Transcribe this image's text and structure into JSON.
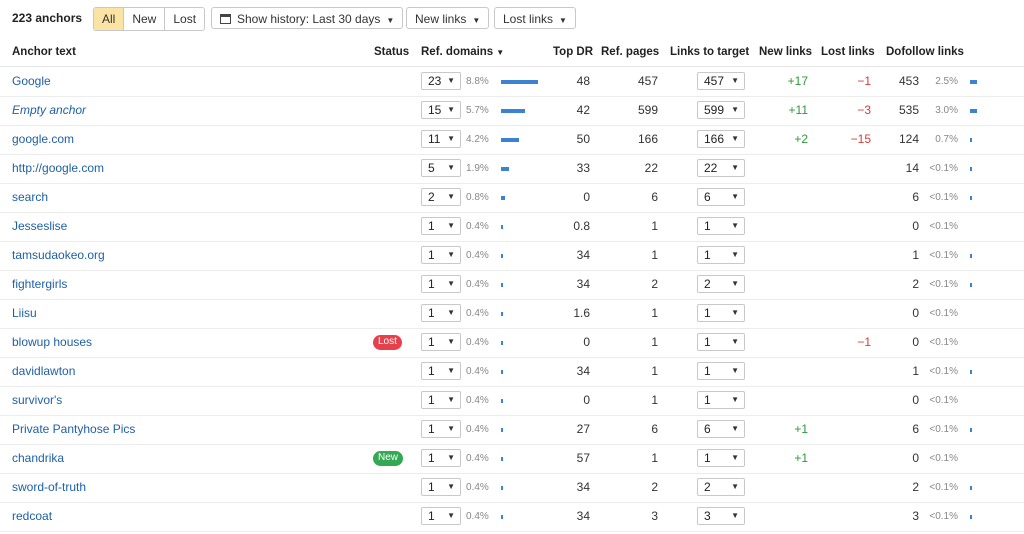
{
  "toolbar": {
    "count_label": "223 anchors",
    "filters": [
      "All",
      "New",
      "Lost"
    ],
    "history_label": "Show history: Last 30 days",
    "new_links_label": "New links",
    "lost_links_label": "Lost links"
  },
  "columns": {
    "anchor": "Anchor text",
    "status": "Status",
    "ref_domains": "Ref. domains",
    "top_dr": "Top DR",
    "ref_pages": "Ref. pages",
    "links_to_target": "Links to target",
    "new_links": "New links",
    "lost_links": "Lost links",
    "dofollow": "Dofollow links"
  },
  "colors": {
    "bar": "#3a83d3",
    "positive": "#2a9a3a",
    "negative": "#d93a3a",
    "lost_badge": "#e8404b",
    "new_badge": "#34a853",
    "active_filter": "#fbe3a4"
  },
  "rows": [
    {
      "anchor": "Google",
      "italic": false,
      "status": "",
      "ref_domains": "23",
      "rd_pct": "8.8%",
      "rd_bar": 1.0,
      "top_dr": "48",
      "ref_pages": "457",
      "links": "457",
      "new": "+17",
      "lost": "−1",
      "dofollow": "453",
      "df_pct": "2.5%",
      "df_bar": 1.0
    },
    {
      "anchor": "Empty anchor",
      "italic": true,
      "status": "",
      "ref_domains": "15",
      "rd_pct": "5.7%",
      "rd_bar": 0.65,
      "top_dr": "42",
      "ref_pages": "599",
      "links": "599",
      "new": "+11",
      "lost": "−3",
      "dofollow": "535",
      "df_pct": "3.0%",
      "df_bar": 1.0
    },
    {
      "anchor": "google.com",
      "italic": false,
      "status": "",
      "ref_domains": "11",
      "rd_pct": "4.2%",
      "rd_bar": 0.48,
      "top_dr": "50",
      "ref_pages": "166",
      "links": "166",
      "new": "+2",
      "lost": "−15",
      "dofollow": "124",
      "df_pct": "0.7%",
      "df_bar": 0.3
    },
    {
      "anchor": "http://google.com",
      "italic": false,
      "status": "",
      "ref_domains": "5",
      "rd_pct": "1.9%",
      "rd_bar": 0.22,
      "top_dr": "33",
      "ref_pages": "22",
      "links": "22",
      "new": "",
      "lost": "",
      "dofollow": "14",
      "df_pct": "<0.1%",
      "df_bar": 0.15
    },
    {
      "anchor": "search",
      "italic": false,
      "status": "",
      "ref_domains": "2",
      "rd_pct": "0.8%",
      "rd_bar": 0.1,
      "top_dr": "0",
      "ref_pages": "6",
      "links": "6",
      "new": "",
      "lost": "",
      "dofollow": "6",
      "df_pct": "<0.1%",
      "df_bar": 0.15
    },
    {
      "anchor": "Jesseslise",
      "italic": false,
      "status": "",
      "ref_domains": "1",
      "rd_pct": "0.4%",
      "rd_bar": 0.05,
      "top_dr": "0.8",
      "ref_pages": "1",
      "links": "1",
      "new": "",
      "lost": "",
      "dofollow": "0",
      "df_pct": "<0.1%",
      "df_bar": 0
    },
    {
      "anchor": "tamsudaokeo.org",
      "italic": false,
      "status": "",
      "ref_domains": "1",
      "rd_pct": "0.4%",
      "rd_bar": 0.05,
      "top_dr": "34",
      "ref_pages": "1",
      "links": "1",
      "new": "",
      "lost": "",
      "dofollow": "1",
      "df_pct": "<0.1%",
      "df_bar": 0.15
    },
    {
      "anchor": "fightergirls",
      "italic": false,
      "status": "",
      "ref_domains": "1",
      "rd_pct": "0.4%",
      "rd_bar": 0.05,
      "top_dr": "34",
      "ref_pages": "2",
      "links": "2",
      "new": "",
      "lost": "",
      "dofollow": "2",
      "df_pct": "<0.1%",
      "df_bar": 0.15
    },
    {
      "anchor": "Liisu",
      "italic": false,
      "status": "",
      "ref_domains": "1",
      "rd_pct": "0.4%",
      "rd_bar": 0.05,
      "top_dr": "1.6",
      "ref_pages": "1",
      "links": "1",
      "new": "",
      "lost": "",
      "dofollow": "0",
      "df_pct": "<0.1%",
      "df_bar": 0
    },
    {
      "anchor": "blowup houses",
      "italic": false,
      "status": "Lost",
      "ref_domains": "1",
      "rd_pct": "0.4%",
      "rd_bar": 0.05,
      "top_dr": "0",
      "ref_pages": "1",
      "links": "1",
      "new": "",
      "lost": "−1",
      "dofollow": "0",
      "df_pct": "<0.1%",
      "df_bar": 0
    },
    {
      "anchor": "davidlawton",
      "italic": false,
      "status": "",
      "ref_domains": "1",
      "rd_pct": "0.4%",
      "rd_bar": 0.05,
      "top_dr": "34",
      "ref_pages": "1",
      "links": "1",
      "new": "",
      "lost": "",
      "dofollow": "1",
      "df_pct": "<0.1%",
      "df_bar": 0.15
    },
    {
      "anchor": "survivor's",
      "italic": false,
      "status": "",
      "ref_domains": "1",
      "rd_pct": "0.4%",
      "rd_bar": 0.05,
      "top_dr": "0",
      "ref_pages": "1",
      "links": "1",
      "new": "",
      "lost": "",
      "dofollow": "0",
      "df_pct": "<0.1%",
      "df_bar": 0
    },
    {
      "anchor": "Private Pantyhose Pics",
      "italic": false,
      "status": "",
      "ref_domains": "1",
      "rd_pct": "0.4%",
      "rd_bar": 0.05,
      "top_dr": "27",
      "ref_pages": "6",
      "links": "6",
      "new": "+1",
      "lost": "",
      "dofollow": "6",
      "df_pct": "<0.1%",
      "df_bar": 0.15
    },
    {
      "anchor": "chandrika",
      "italic": false,
      "status": "New",
      "ref_domains": "1",
      "rd_pct": "0.4%",
      "rd_bar": 0.05,
      "top_dr": "57",
      "ref_pages": "1",
      "links": "1",
      "new": "+1",
      "lost": "",
      "dofollow": "0",
      "df_pct": "<0.1%",
      "df_bar": 0
    },
    {
      "anchor": "sword-of-truth",
      "italic": false,
      "status": "",
      "ref_domains": "1",
      "rd_pct": "0.4%",
      "rd_bar": 0.05,
      "top_dr": "34",
      "ref_pages": "2",
      "links": "2",
      "new": "",
      "lost": "",
      "dofollow": "2",
      "df_pct": "<0.1%",
      "df_bar": 0.15
    },
    {
      "anchor": "redcoat",
      "italic": false,
      "status": "",
      "ref_domains": "1",
      "rd_pct": "0.4%",
      "rd_bar": 0.05,
      "top_dr": "34",
      "ref_pages": "3",
      "links": "3",
      "new": "",
      "lost": "",
      "dofollow": "3",
      "df_pct": "<0.1%",
      "df_bar": 0.15
    }
  ]
}
